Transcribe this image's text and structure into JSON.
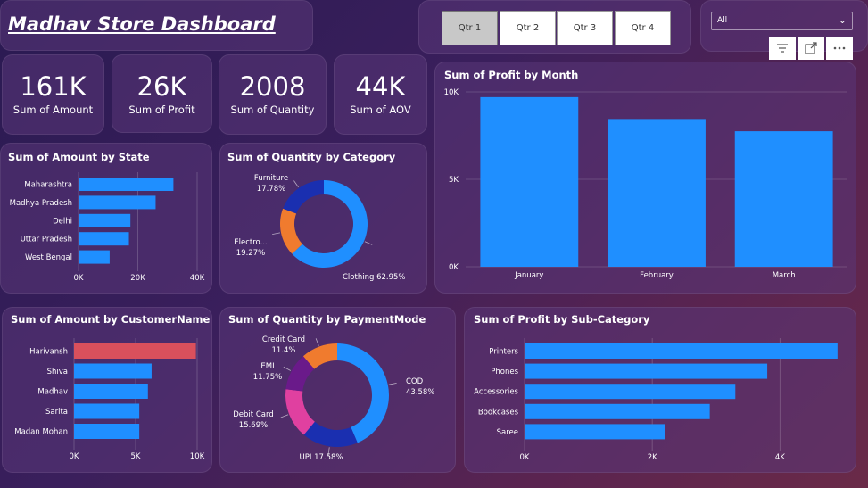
{
  "header": {
    "title": "Madhav Store Dashboard"
  },
  "quarters": {
    "options": [
      "Qtr 1",
      "Qtr 2",
      "Qtr 3",
      "Qtr 4"
    ],
    "selected": "Qtr 1"
  },
  "slicer": {
    "value": "All"
  },
  "visual_header_icons": [
    "filter-icon",
    "focus-mode-icon",
    "more-options-icon"
  ],
  "kpis": [
    {
      "value": "161K",
      "label": "Sum of Amount"
    },
    {
      "value": "26K",
      "label": "Sum of Profit"
    },
    {
      "value": "2008",
      "label": "Sum of Quantity"
    },
    {
      "value": "44K",
      "label": "Sum of AOV"
    }
  ],
  "colors": {
    "bar": "#1f8fff",
    "highlight": "#d9505c",
    "furniture": "#f07b2e",
    "electronics": "#1a2fb0",
    "clothing": "#1f8fff",
    "credit_card": "#f07b2e",
    "emi": "#6a1a8a",
    "debit_card": "#e040a0",
    "upi": "#1a2fb0",
    "cod": "#1f8fff"
  },
  "chart_data": [
    {
      "id": "amount_by_state",
      "type": "bar",
      "orientation": "horizontal",
      "title": "Sum of Amount by State",
      "categories": [
        "Maharashtra",
        "Madhya Pradesh",
        "Delhi",
        "Uttar Pradesh",
        "West Bengal"
      ],
      "values": [
        32000,
        26000,
        17500,
        17000,
        10500
      ],
      "xlim": [
        0,
        40000
      ],
      "ticks": [
        "0K",
        "20K",
        "40K"
      ],
      "tick_values": [
        0,
        20000,
        40000
      ]
    },
    {
      "id": "quantity_by_category",
      "type": "pie",
      "donut": true,
      "title": "Sum of Quantity by Category",
      "labels": [
        "Furniture",
        "Electro...",
        "Clothing"
      ],
      "values": [
        17.78,
        19.27,
        62.95
      ],
      "percent_labels": [
        "17.78%",
        "19.27%",
        "62.95%"
      ]
    },
    {
      "id": "profit_by_month",
      "type": "bar",
      "orientation": "vertical",
      "title": "Sum of Profit by Month",
      "categories": [
        "January",
        "February",
        "March"
      ],
      "values": [
        9700,
        8450,
        7750
      ],
      "ylim": [
        0,
        10000
      ],
      "ticks": [
        "0K",
        "5K",
        "10K"
      ],
      "tick_values": [
        0,
        5000,
        10000
      ]
    },
    {
      "id": "amount_by_customer",
      "type": "bar",
      "orientation": "horizontal",
      "title": "Sum of Amount by CustomerName",
      "categories": [
        "Harivansh",
        "Shiva",
        "Madhav",
        "Sarita",
        "Madan Mohan"
      ],
      "values": [
        9900,
        6300,
        6000,
        5300,
        5300
      ],
      "xlim": [
        0,
        10000
      ],
      "ticks": [
        "0K",
        "5K",
        "10K"
      ],
      "tick_values": [
        0,
        5000,
        10000
      ]
    },
    {
      "id": "quantity_by_payment",
      "type": "pie",
      "donut": true,
      "title": "Sum of Quantity by PaymentMode",
      "labels": [
        "COD",
        "UPI",
        "Debit Card",
        "EMI",
        "Credit Card"
      ],
      "values": [
        43.58,
        17.58,
        15.69,
        11.75,
        11.4
      ],
      "percent_labels": [
        "43.58%",
        "17.58%",
        "15.69%",
        "11.75%",
        "11.4%"
      ]
    },
    {
      "id": "profit_by_subcategory",
      "type": "bar",
      "orientation": "horizontal",
      "title": "Sum of Profit by Sub-Category",
      "categories": [
        "Printers",
        "Phones",
        "Accessories",
        "Bookcases",
        "Saree"
      ],
      "values": [
        4900,
        3800,
        3300,
        2900,
        2200
      ],
      "xlim": [
        0,
        5000
      ],
      "ticks": [
        "0K",
        "2K",
        "4K"
      ],
      "tick_values": [
        0,
        2000,
        4000
      ]
    }
  ]
}
